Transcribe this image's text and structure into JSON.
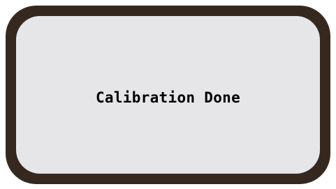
{
  "display": {
    "message": "Calibration Done"
  },
  "colors": {
    "bezel": "#35291f",
    "screen": "#e6e6e8",
    "text": "#000000"
  }
}
